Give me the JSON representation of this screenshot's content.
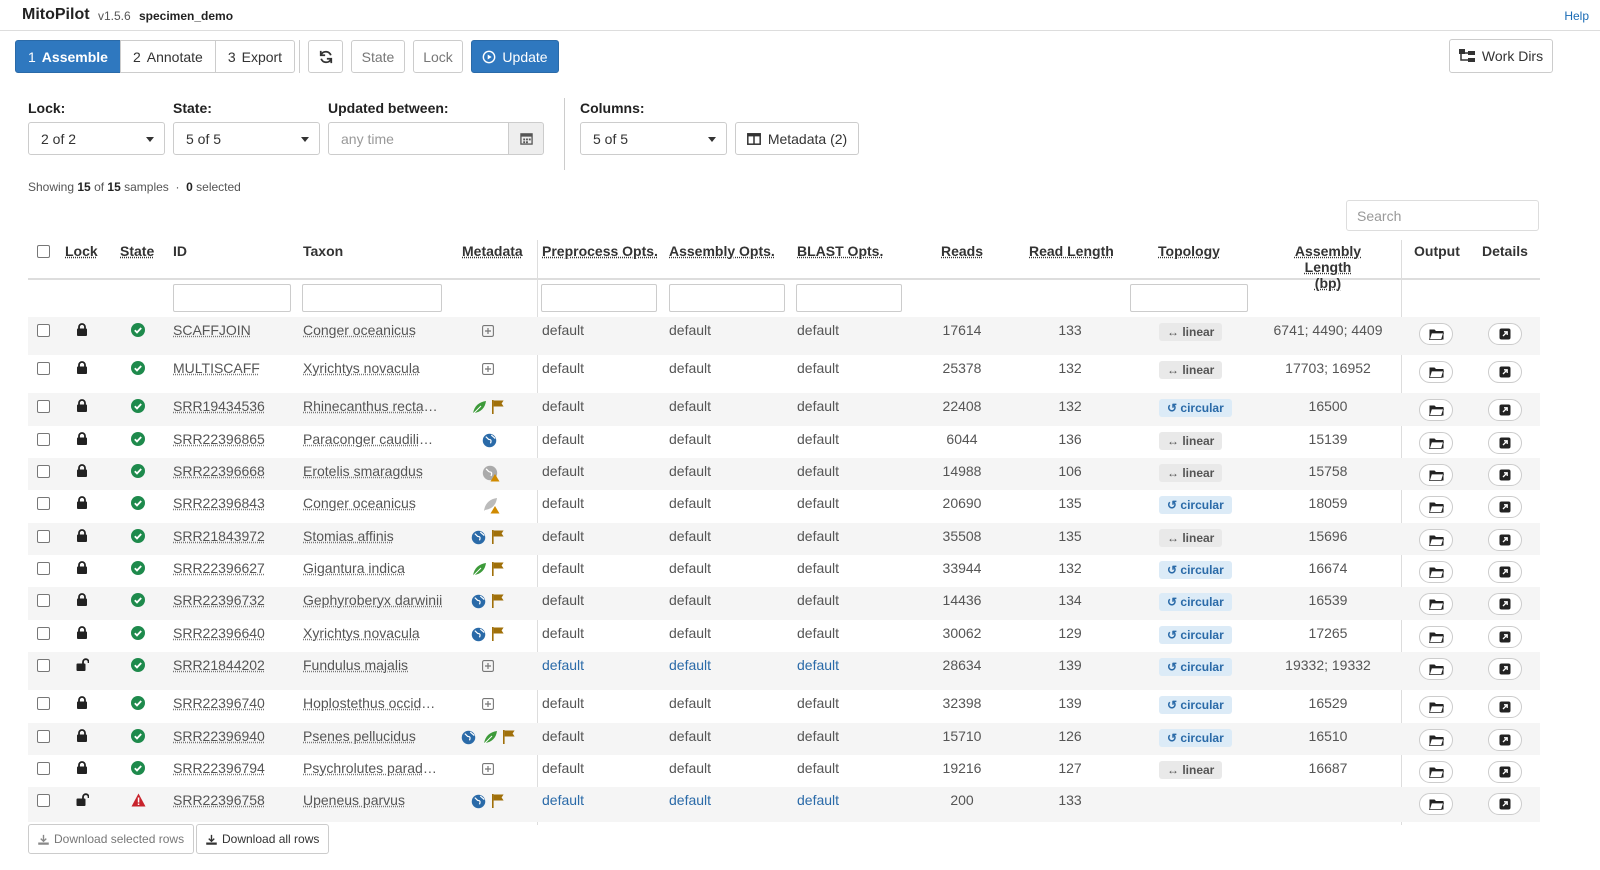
{
  "app": {
    "title": "MitoPilot",
    "version": "v1.5.6",
    "project": "specimen_demo",
    "help_label": "Help"
  },
  "toolbar": {
    "steps": [
      {
        "num": "1",
        "label": "Assemble",
        "active": true
      },
      {
        "num": "2",
        "label": "Annotate",
        "active": false
      },
      {
        "num": "3",
        "label": "Export",
        "active": false
      }
    ],
    "refresh_icon": "refresh-icon",
    "state_label": "State",
    "lock_label": "Lock",
    "update_label": "Update",
    "workdirs_label": "Work Dirs"
  },
  "filters": {
    "lock": {
      "label": "Lock:",
      "value": "2 of 2"
    },
    "state": {
      "label": "State:",
      "value": "5 of 5"
    },
    "updated": {
      "label": "Updated between:",
      "placeholder": "any time"
    },
    "columns": {
      "label": "Columns:",
      "value": "5 of 5"
    },
    "metadata_label": "Metadata (2)"
  },
  "summary": {
    "showing": "15",
    "total": "15",
    "selected": "0"
  },
  "search_placeholder": "Search",
  "columns": {
    "lock": "Lock",
    "state": "State",
    "id": "ID",
    "taxon": "Taxon",
    "metadata": "Metadata",
    "preprocess": "Preprocess Opts.",
    "assembly": "Assembly Opts.",
    "blast": "BLAST Opts.",
    "reads": "Reads",
    "read_length": "Read Length",
    "topology": "Topology",
    "assembly_length_1": "Assembly Length",
    "assembly_length_2": "(bp)",
    "output": "Output",
    "details": "Details"
  },
  "rows": [
    {
      "id": "SCAFFJOIN",
      "taxon": "Conger oceanicus",
      "meta": [
        "plus"
      ],
      "locked": true,
      "state": "ok",
      "pre": "default",
      "asm": "default",
      "blast": "default",
      "opt_link": false,
      "reads": "17614",
      "readlen": "133",
      "topology": "linear",
      "asmlen": "6741; 4490; 4409"
    },
    {
      "id": "MULTISCAFF",
      "taxon": "Xyrichtys novacula",
      "meta": [
        "plus"
      ],
      "locked": true,
      "state": "ok",
      "pre": "default",
      "asm": "default",
      "blast": "default",
      "opt_link": false,
      "reads": "25378",
      "readlen": "132",
      "topology": "linear",
      "asmlen": "17703; 16952"
    },
    {
      "id": "SRR19434536",
      "taxon": "Rhinecanthus rectangulus",
      "meta": [
        "leaf",
        "flag"
      ],
      "locked": true,
      "state": "ok",
      "pre": "default",
      "asm": "default",
      "blast": "default",
      "opt_link": false,
      "reads": "22408",
      "readlen": "132",
      "topology": "circular",
      "asmlen": "16500"
    },
    {
      "id": "SRR22396865",
      "taxon": "Paraconger caudilimbatus",
      "meta": [
        "globe"
      ],
      "locked": true,
      "state": "ok",
      "pre": "default",
      "asm": "default",
      "blast": "default",
      "opt_link": false,
      "reads": "6044",
      "readlen": "136",
      "topology": "linear",
      "asmlen": "15139"
    },
    {
      "id": "SRR22396668",
      "taxon": "Erotelis smaragdus",
      "meta": [
        "globe-warn"
      ],
      "locked": true,
      "state": "ok",
      "pre": "default",
      "asm": "default",
      "blast": "default",
      "opt_link": false,
      "reads": "14988",
      "readlen": "106",
      "topology": "linear",
      "asmlen": "15758"
    },
    {
      "id": "SRR22396843",
      "taxon": "Conger oceanicus",
      "meta": [
        "leaf-warn"
      ],
      "locked": true,
      "state": "ok",
      "pre": "default",
      "asm": "default",
      "blast": "default",
      "opt_link": false,
      "reads": "20690",
      "readlen": "135",
      "topology": "circular",
      "asmlen": "18059"
    },
    {
      "id": "SRR21843972",
      "taxon": "Stomias affinis",
      "meta": [
        "globe",
        "flag"
      ],
      "locked": true,
      "state": "ok",
      "pre": "default",
      "asm": "default",
      "blast": "default",
      "opt_link": false,
      "reads": "35508",
      "readlen": "135",
      "topology": "linear",
      "asmlen": "15696"
    },
    {
      "id": "SRR22396627",
      "taxon": "Gigantura indica",
      "meta": [
        "leaf",
        "flag"
      ],
      "locked": true,
      "state": "ok",
      "pre": "default",
      "asm": "default",
      "blast": "default",
      "opt_link": false,
      "reads": "33944",
      "readlen": "132",
      "topology": "circular",
      "asmlen": "16674"
    },
    {
      "id": "SRR22396732",
      "taxon": "Gephyroberyx darwinii",
      "meta": [
        "globe",
        "flag"
      ],
      "locked": true,
      "state": "ok",
      "pre": "default",
      "asm": "default",
      "blast": "default",
      "opt_link": false,
      "reads": "14436",
      "readlen": "134",
      "topology": "circular",
      "asmlen": "16539"
    },
    {
      "id": "SRR22396640",
      "taxon": "Xyrichtys novacula",
      "meta": [
        "globe",
        "flag"
      ],
      "locked": true,
      "state": "ok",
      "pre": "default",
      "asm": "default",
      "blast": "default",
      "opt_link": false,
      "reads": "30062",
      "readlen": "129",
      "topology": "circular",
      "asmlen": "17265"
    },
    {
      "id": "SRR21844202",
      "taxon": "Fundulus majalis",
      "meta": [
        "plus"
      ],
      "locked": false,
      "state": "ok",
      "pre": "default",
      "asm": "default",
      "blast": "default",
      "opt_link": true,
      "reads": "28634",
      "readlen": "139",
      "topology": "circular",
      "asmlen": "19332; 19332"
    },
    {
      "id": "SRR22396740",
      "taxon": "Hoplostethus occidentalis",
      "meta": [
        "plus"
      ],
      "locked": true,
      "state": "ok",
      "pre": "default",
      "asm": "default",
      "blast": "default",
      "opt_link": false,
      "reads": "32398",
      "readlen": "139",
      "topology": "circular",
      "asmlen": "16529"
    },
    {
      "id": "SRR22396940",
      "taxon": "Psenes pellucidus",
      "meta": [
        "globe",
        "leaf",
        "flag"
      ],
      "locked": true,
      "state": "ok",
      "pre": "default",
      "asm": "default",
      "blast": "default",
      "opt_link": false,
      "reads": "15710",
      "readlen": "126",
      "topology": "circular",
      "asmlen": "16510"
    },
    {
      "id": "SRR22396794",
      "taxon": "Psychrolutes paradoxus",
      "meta": [
        "plus"
      ],
      "locked": true,
      "state": "ok",
      "pre": "default",
      "asm": "default",
      "blast": "default",
      "opt_link": false,
      "reads": "19216",
      "readlen": "127",
      "topology": "linear",
      "asmlen": "16687"
    },
    {
      "id": "SRR22396758",
      "taxon": "Upeneus parvus",
      "meta": [
        "globe",
        "flag"
      ],
      "locked": false,
      "state": "error",
      "pre": "default",
      "asm": "default",
      "blast": "default",
      "opt_link": true,
      "reads": "200",
      "readlen": "133",
      "topology": "",
      "asmlen": ""
    }
  ],
  "topology_labels": {
    "linear": "↔ linear",
    "circular": "↺ circular"
  },
  "download": {
    "selected": "Download selected rows",
    "all": "Download all rows"
  },
  "colors": {
    "primary": "#2f78bf",
    "success": "#1e8a4c",
    "danger": "#c8232c",
    "flag": "#a0700a",
    "leaf": "#3d9a3a",
    "link": "#2a6aa8"
  }
}
